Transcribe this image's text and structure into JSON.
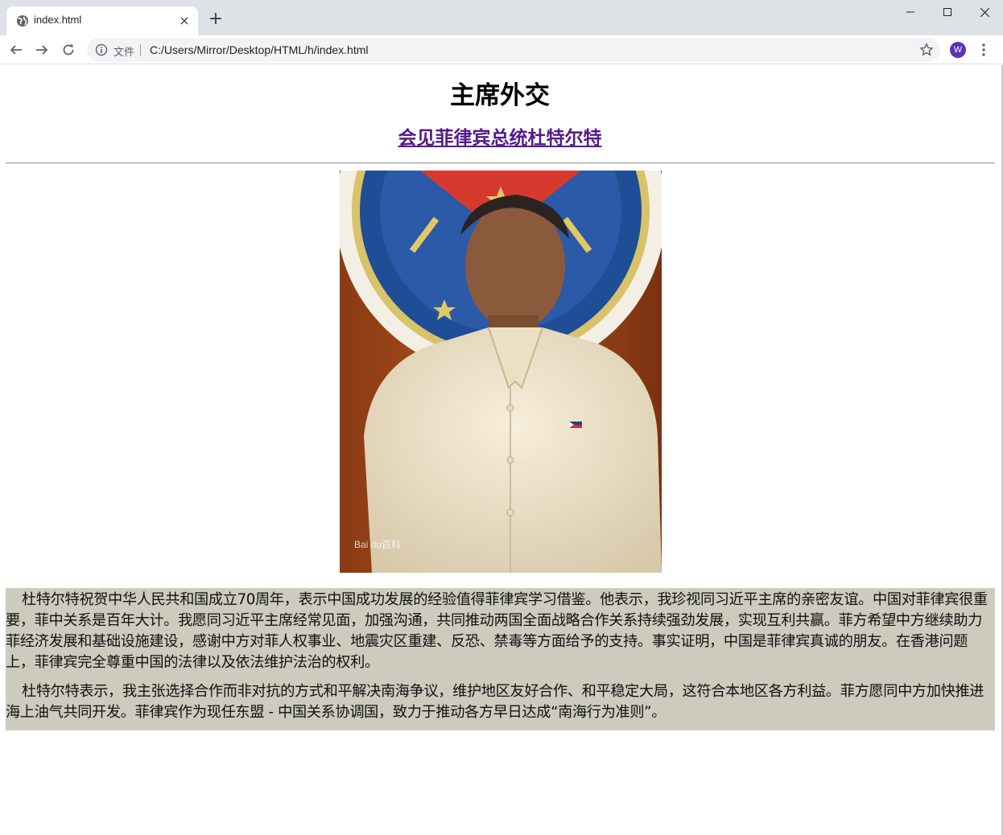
{
  "browser": {
    "tab_title": "index.html",
    "tab_close": "×",
    "new_tab": "+",
    "file_label": "文件",
    "url": "C:/Users/Mirror/Desktop/HTML/h/index.html",
    "avatar_letter": "W",
    "icons": [
      "globe-icon",
      "back-arrow-icon",
      "forward-arrow-icon",
      "reload-icon",
      "info-icon",
      "star-icon",
      "kebab-menu-icon",
      "minimize-icon",
      "maximize-icon",
      "close-icon"
    ]
  },
  "page": {
    "title": "主席外交",
    "subtitle_link": "会见菲律宾总统杜特尔特",
    "photo_watermark": "Bai du百科",
    "paragraphs": [
      "杜特尔特祝贺中华人民共和国成立70周年，表示中国成功发展的经验值得菲律宾学习借鉴。他表示，我珍视同习近平主席的亲密友谊。中国对菲律宾很重要，菲中关系是百年大计。我愿同习近平主席经常见面，加强沟通，共同推动两国全面战略合作关系持续强劲发展，实现互利共赢。菲方希望中方继续助力菲经济发展和基础设施建设，感谢中方对菲人权事业、地震灾区重建、反恐、禁毒等方面给予的支持。事实证明，中国是菲律宾真诚的朋友。在香港问题上，菲律宾完全尊重中国的法律以及依法维护法治的权利。",
      "杜特尔特表示，我主张选择合作而非对抗的方式和平解决南海争议，维护地区友好合作、和平稳定大局，这符合本地区各方利益。菲方愿同中方加快推进海上油气共同开发。菲律宾作为现任东盟 - 中国关系协调国，致力于推动各方早日达成“南海行为准则”。"
    ]
  },
  "colors": {
    "link_visited": "#551a8b",
    "article_bg": "#cccbbe",
    "avatar_bg": "#5b33b8"
  }
}
